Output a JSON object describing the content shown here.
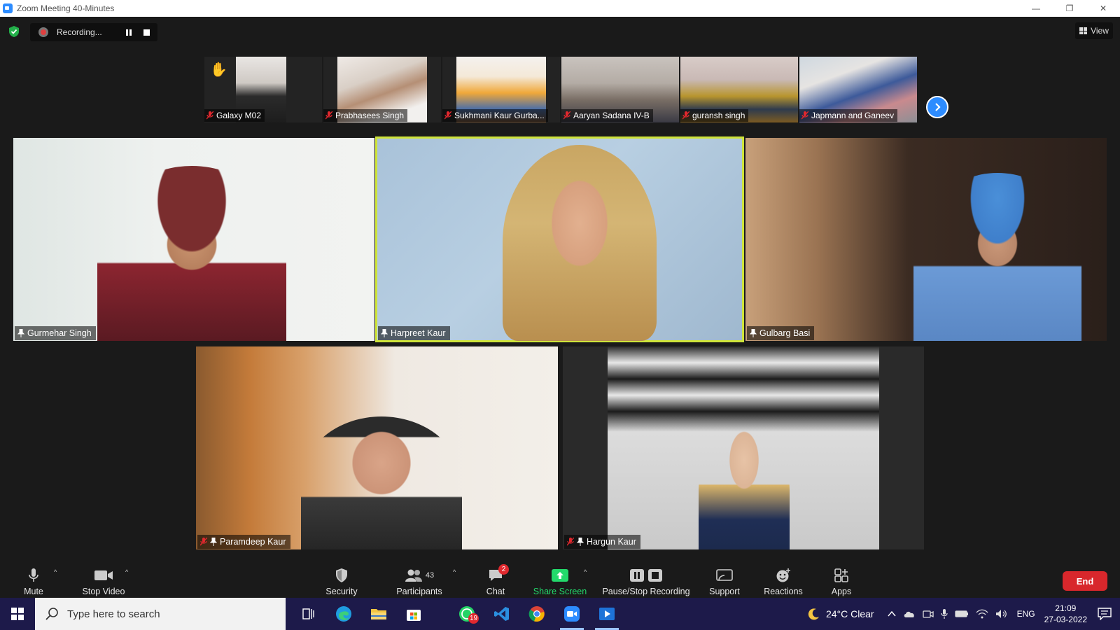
{
  "window": {
    "title": "Zoom Meeting 40-Minutes",
    "controls": [
      "—",
      "❐",
      "✕"
    ]
  },
  "recording": {
    "status": "Recording..."
  },
  "view_button": {
    "label": "View"
  },
  "thumbnails": [
    {
      "name": "Galaxy M02",
      "muted": true,
      "raised_hand": true
    },
    {
      "name": "Prabhasees Singh",
      "muted": true
    },
    {
      "name": "Sukhmani Kaur Gurba...",
      "muted": true
    },
    {
      "name": "Aaryan Sadana IV-B",
      "muted": true
    },
    {
      "name": "guransh singh",
      "muted": true
    },
    {
      "name": "Japmann and Ganeev",
      "muted": true
    }
  ],
  "tiles": [
    {
      "name": "Gurmehar Singh",
      "pinned": true,
      "muted": false,
      "active": false
    },
    {
      "name": "Harpreet Kaur",
      "pinned": true,
      "muted": false,
      "active": true
    },
    {
      "name": "Gulbarg Basi",
      "pinned": true,
      "muted": false,
      "active": false
    },
    {
      "name": "Paramdeep Kaur",
      "pinned": true,
      "muted": true,
      "active": false
    },
    {
      "name": "Hargun Kaur",
      "pinned": true,
      "muted": true,
      "active": false
    }
  ],
  "toolbar": {
    "mute": "Mute",
    "stop_video": "Stop Video",
    "security": "Security",
    "participants": "Participants",
    "participants_count": "43",
    "chat": "Chat",
    "chat_badge": "2",
    "share_screen": "Share Screen",
    "pause_stop_recording": "Pause/Stop Recording",
    "support": "Support",
    "reactions": "Reactions",
    "apps": "Apps",
    "end": "End"
  },
  "taskbar": {
    "search_placeholder": "Type here to search",
    "whatsapp_badge": "19",
    "weather": "24°C  Clear",
    "language": "ENG",
    "time": "21:09",
    "date": "27-03-2022"
  },
  "colors": {
    "accent": "#2D8CFF",
    "share_green": "#23D96B",
    "end_red": "#D8272C",
    "active_speaker": "#CFE43A",
    "taskbar": "#1D1A4A"
  }
}
